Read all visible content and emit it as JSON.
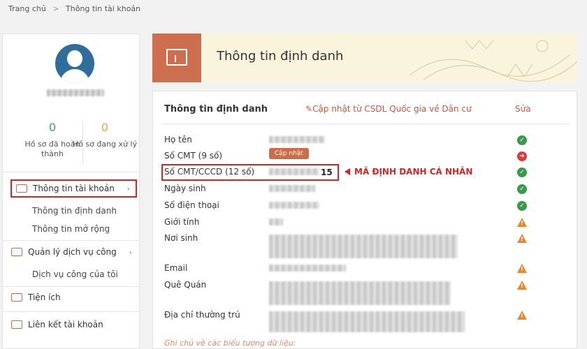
{
  "breadcrumb": {
    "home": "Trang chủ",
    "separator": ">",
    "current": "Thông tin tài khoản"
  },
  "sidebar": {
    "stats": [
      {
        "count": "0",
        "label": "Hồ sơ đã hoàn thành"
      },
      {
        "count": "0",
        "label": "Hồ sơ đang xử lý"
      }
    ],
    "menu": [
      {
        "label": "Thông tin tài khoản",
        "active": true
      },
      {
        "label": "Thông tin định danh"
      },
      {
        "label": "Thông tin mở rộng"
      },
      {
        "label": "Quản lý dịch vụ công"
      },
      {
        "label": "Dịch vụ công của tôi"
      },
      {
        "label": "Tiện ích"
      },
      {
        "label": "Liên kết tài khoản"
      }
    ]
  },
  "header": {
    "title": "Thông tin định danh"
  },
  "card": {
    "title": "Thông tin định danh",
    "update_link": "Cập nhật từ CSDL Quốc gia về Dân cư",
    "edit_link": "Sửa",
    "update_pill": "Cập nhật",
    "id12_suffix": "15",
    "callout": "MÃ ĐỊNH DANH CÁ NHÂN",
    "legend_note": "Ghi chú về các biểu tượng dữ liệu:",
    "rows": [
      {
        "label": "Họ tên",
        "status": "ok"
      },
      {
        "label": "Số CMT (9 số)",
        "status": "error"
      },
      {
        "label": "Số CMT/CCCD (12 số)",
        "status": "ok"
      },
      {
        "label": "Ngày sinh",
        "status": "ok"
      },
      {
        "label": "Số điện thoại",
        "status": "ok"
      },
      {
        "label": "Giới tính",
        "status": "warning"
      },
      {
        "label": "Nơi sinh",
        "status": "warning"
      },
      {
        "label": "Email",
        "status": "warning"
      },
      {
        "label": "Quê Quán",
        "status": "warning"
      },
      {
        "label": "Địa chỉ thường trú",
        "status": "warning"
      }
    ]
  },
  "colors": {
    "accent": "#cd6f4e",
    "highlight": "#d32525",
    "ok": "#3a9a4a",
    "warning": "#e8872c",
    "error": "#d93a3a"
  }
}
